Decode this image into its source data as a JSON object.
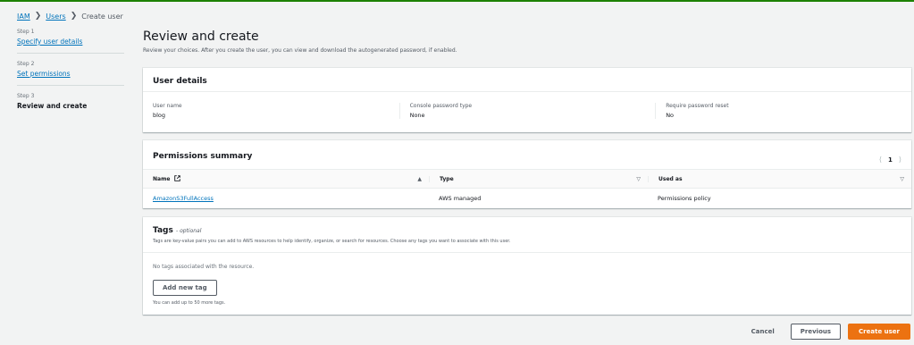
{
  "colors": {
    "accent": "#ec7211",
    "link": "#0073bb",
    "success_bar": "#1d8102"
  },
  "breadcrumb": {
    "iam": "IAM",
    "users": "Users",
    "current": "Create user",
    "separator": "❯"
  },
  "steps": [
    {
      "num": "Step 1",
      "label": "Specify user details"
    },
    {
      "num": "Step 2",
      "label": "Set permissions"
    },
    {
      "num": "Step 3",
      "label": "Review and create"
    }
  ],
  "page": {
    "title": "Review and create",
    "subtitle": "Review your choices. After you create the user, you can view and download the autogenerated password, if enabled."
  },
  "user_details": {
    "title": "User details",
    "fields": [
      {
        "label": "User name",
        "value": "blog"
      },
      {
        "label": "Console password type",
        "value": "None"
      },
      {
        "label": "Require password reset",
        "value": "No"
      }
    ]
  },
  "permissions": {
    "title": "Permissions summary",
    "page": "1",
    "columns": [
      "Name",
      "Type",
      "Used as"
    ],
    "rows": [
      {
        "name": "AmazonS3FullAccess",
        "type": "AWS managed",
        "used_as": "Permissions policy"
      }
    ]
  },
  "tags": {
    "title": "Tags",
    "optional": "- optional",
    "description": "Tags are key-value pairs you can add to AWS resources to help identify, organize, or search for resources. Choose any tags you want to associate with this user.",
    "empty": "No tags associated with the resource.",
    "add_button": "Add new tag",
    "hint": "You can add up to 50 more tags."
  },
  "footer": {
    "cancel": "Cancel",
    "previous": "Previous",
    "create": "Create user"
  }
}
